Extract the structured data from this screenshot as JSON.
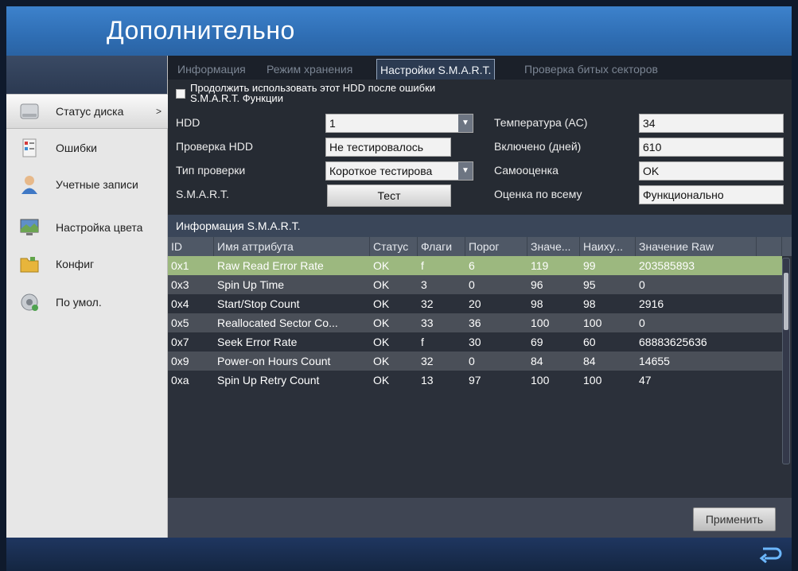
{
  "window": {
    "title": "Дополнительно"
  },
  "sidebar": {
    "items": [
      {
        "label": "Статус диска",
        "icon": "disk-icon",
        "active": true,
        "arrow": ">"
      },
      {
        "label": "Ошибки",
        "icon": "exception-icon"
      },
      {
        "label": "Учетные записи",
        "icon": "user-icon"
      },
      {
        "label": "Настройка цвета",
        "icon": "display-icon"
      },
      {
        "label": "Конфиг",
        "icon": "folder-icon"
      },
      {
        "label": "По умол.",
        "icon": "default-icon"
      }
    ]
  },
  "tabs": [
    {
      "label": "Информация",
      "active": false
    },
    {
      "label": "Режим хранения",
      "active": false
    },
    {
      "label": "Настройки S.M.A.R.T.",
      "active": true
    },
    {
      "label": "Проверка битых секторов",
      "active": false
    }
  ],
  "options": {
    "continue_line1": "Продолжить использовать этот HDD после ошибки",
    "continue_line2": "S.M.A.R.T. Функции"
  },
  "form": {
    "hdd_label": "HDD",
    "hdd_value": "1",
    "check_label": "Проверка HDD",
    "check_value": "Не тестировалось",
    "type_label": "Тип проверки",
    "type_value": "Короткое тестирова",
    "smart_label": "S.M.A.R.T.",
    "test_button": "Тест",
    "temp_label": "Температура (AC)",
    "temp_value": "34",
    "powered_label": "Включено (дней)",
    "powered_value": "610",
    "selfeval_label": "Самооценка",
    "selfeval_value": "OK",
    "overall_label": "Оценка по всему",
    "overall_value": "Функционально"
  },
  "smart_info": {
    "header": "Информация S.M.A.R.T.",
    "columns": [
      "ID",
      "Имя аттрибута",
      "Статус",
      "Флаги",
      "Порог",
      "Значе...",
      "Наиху...",
      "Значение Raw"
    ],
    "rows": [
      [
        "0x1",
        "Raw Read Error Rate",
        "OK",
        "f",
        "6",
        "119",
        "99",
        "203585893"
      ],
      [
        "0x3",
        "Spin Up Time",
        "OK",
        "3",
        "0",
        "96",
        "95",
        "0"
      ],
      [
        "0x4",
        "Start/Stop Count",
        "OK",
        "32",
        "20",
        "98",
        "98",
        "2916"
      ],
      [
        "0x5",
        "Reallocated Sector Co...",
        "OK",
        "33",
        "36",
        "100",
        "100",
        "0"
      ],
      [
        "0x7",
        "Seek Error Rate",
        "OK",
        "f",
        "30",
        "69",
        "60",
        "68883625636"
      ],
      [
        "0x9",
        "Power-on Hours Count",
        "OK",
        "32",
        "0",
        "84",
        "84",
        "14655"
      ],
      [
        "0xa",
        "Spin Up Retry Count",
        "OK",
        "13",
        "97",
        "100",
        "100",
        "47"
      ]
    ],
    "selected_row": 0
  },
  "actions": {
    "apply": "Применить"
  },
  "colors": {
    "header_blue": "#2f6eb4",
    "selected_row": "#9cb87f",
    "panel_dark": "#262b33"
  }
}
